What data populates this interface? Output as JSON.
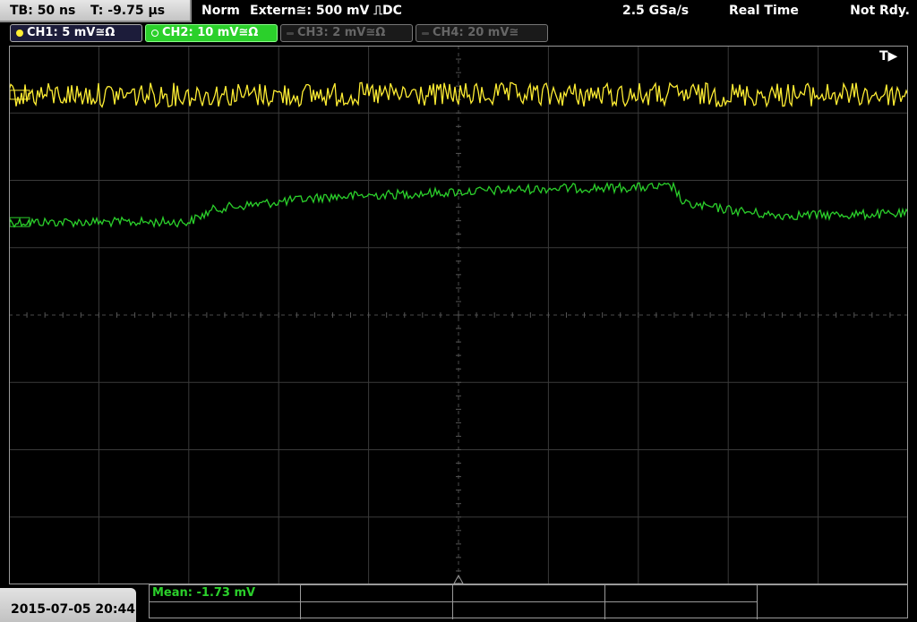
{
  "topbar": {
    "timebase": "TB: 50 ns",
    "trigger_position": "T: -9.75 µs",
    "trigger_mode": "Norm",
    "trigger_source": "Extern≅: 500 mV ⎍DC",
    "sample_rate": "2.5 GSa/s",
    "acquisition_mode": "Real Time",
    "status": "Not Rdy."
  },
  "channels": [
    {
      "label": "CH1: 5 mV≅Ω",
      "color": "#ffee33",
      "active": true
    },
    {
      "label": "CH2: 10 mV≅Ω",
      "color": "#2bd02b",
      "active": true,
      "selected": true
    },
    {
      "label": "CH3: 2 mV≅Ω",
      "color": "#555555",
      "active": false
    },
    {
      "label": "CH4: 20 mV≅",
      "color": "#555555",
      "active": false
    }
  ],
  "trigger_marker": "T▶",
  "measurement": {
    "mean": "Mean: -1.73 mV"
  },
  "datetime": "2015-07-05 20:44",
  "chart_data": {
    "type": "line",
    "grid": true,
    "divisions": {
      "x": 10,
      "y": 8
    },
    "series": [
      {
        "name": "CH2",
        "color": "#2bd02b",
        "segments": [
          [
            0,
            2.62
          ],
          [
            2.0,
            2.62
          ],
          [
            2.3,
            2.42
          ],
          [
            3.5,
            2.25
          ],
          [
            6.0,
            2.12
          ],
          [
            7.4,
            2.1
          ],
          [
            7.5,
            2.35
          ],
          [
            8.5,
            2.52
          ],
          [
            10.0,
            2.5
          ]
        ],
        "noise": 0.07
      },
      {
        "name": "CH1",
        "color": "#ffee33",
        "segments": [
          [
            0,
            0.73
          ],
          [
            10.0,
            0.73
          ]
        ],
        "noise": 0.18
      }
    ]
  }
}
